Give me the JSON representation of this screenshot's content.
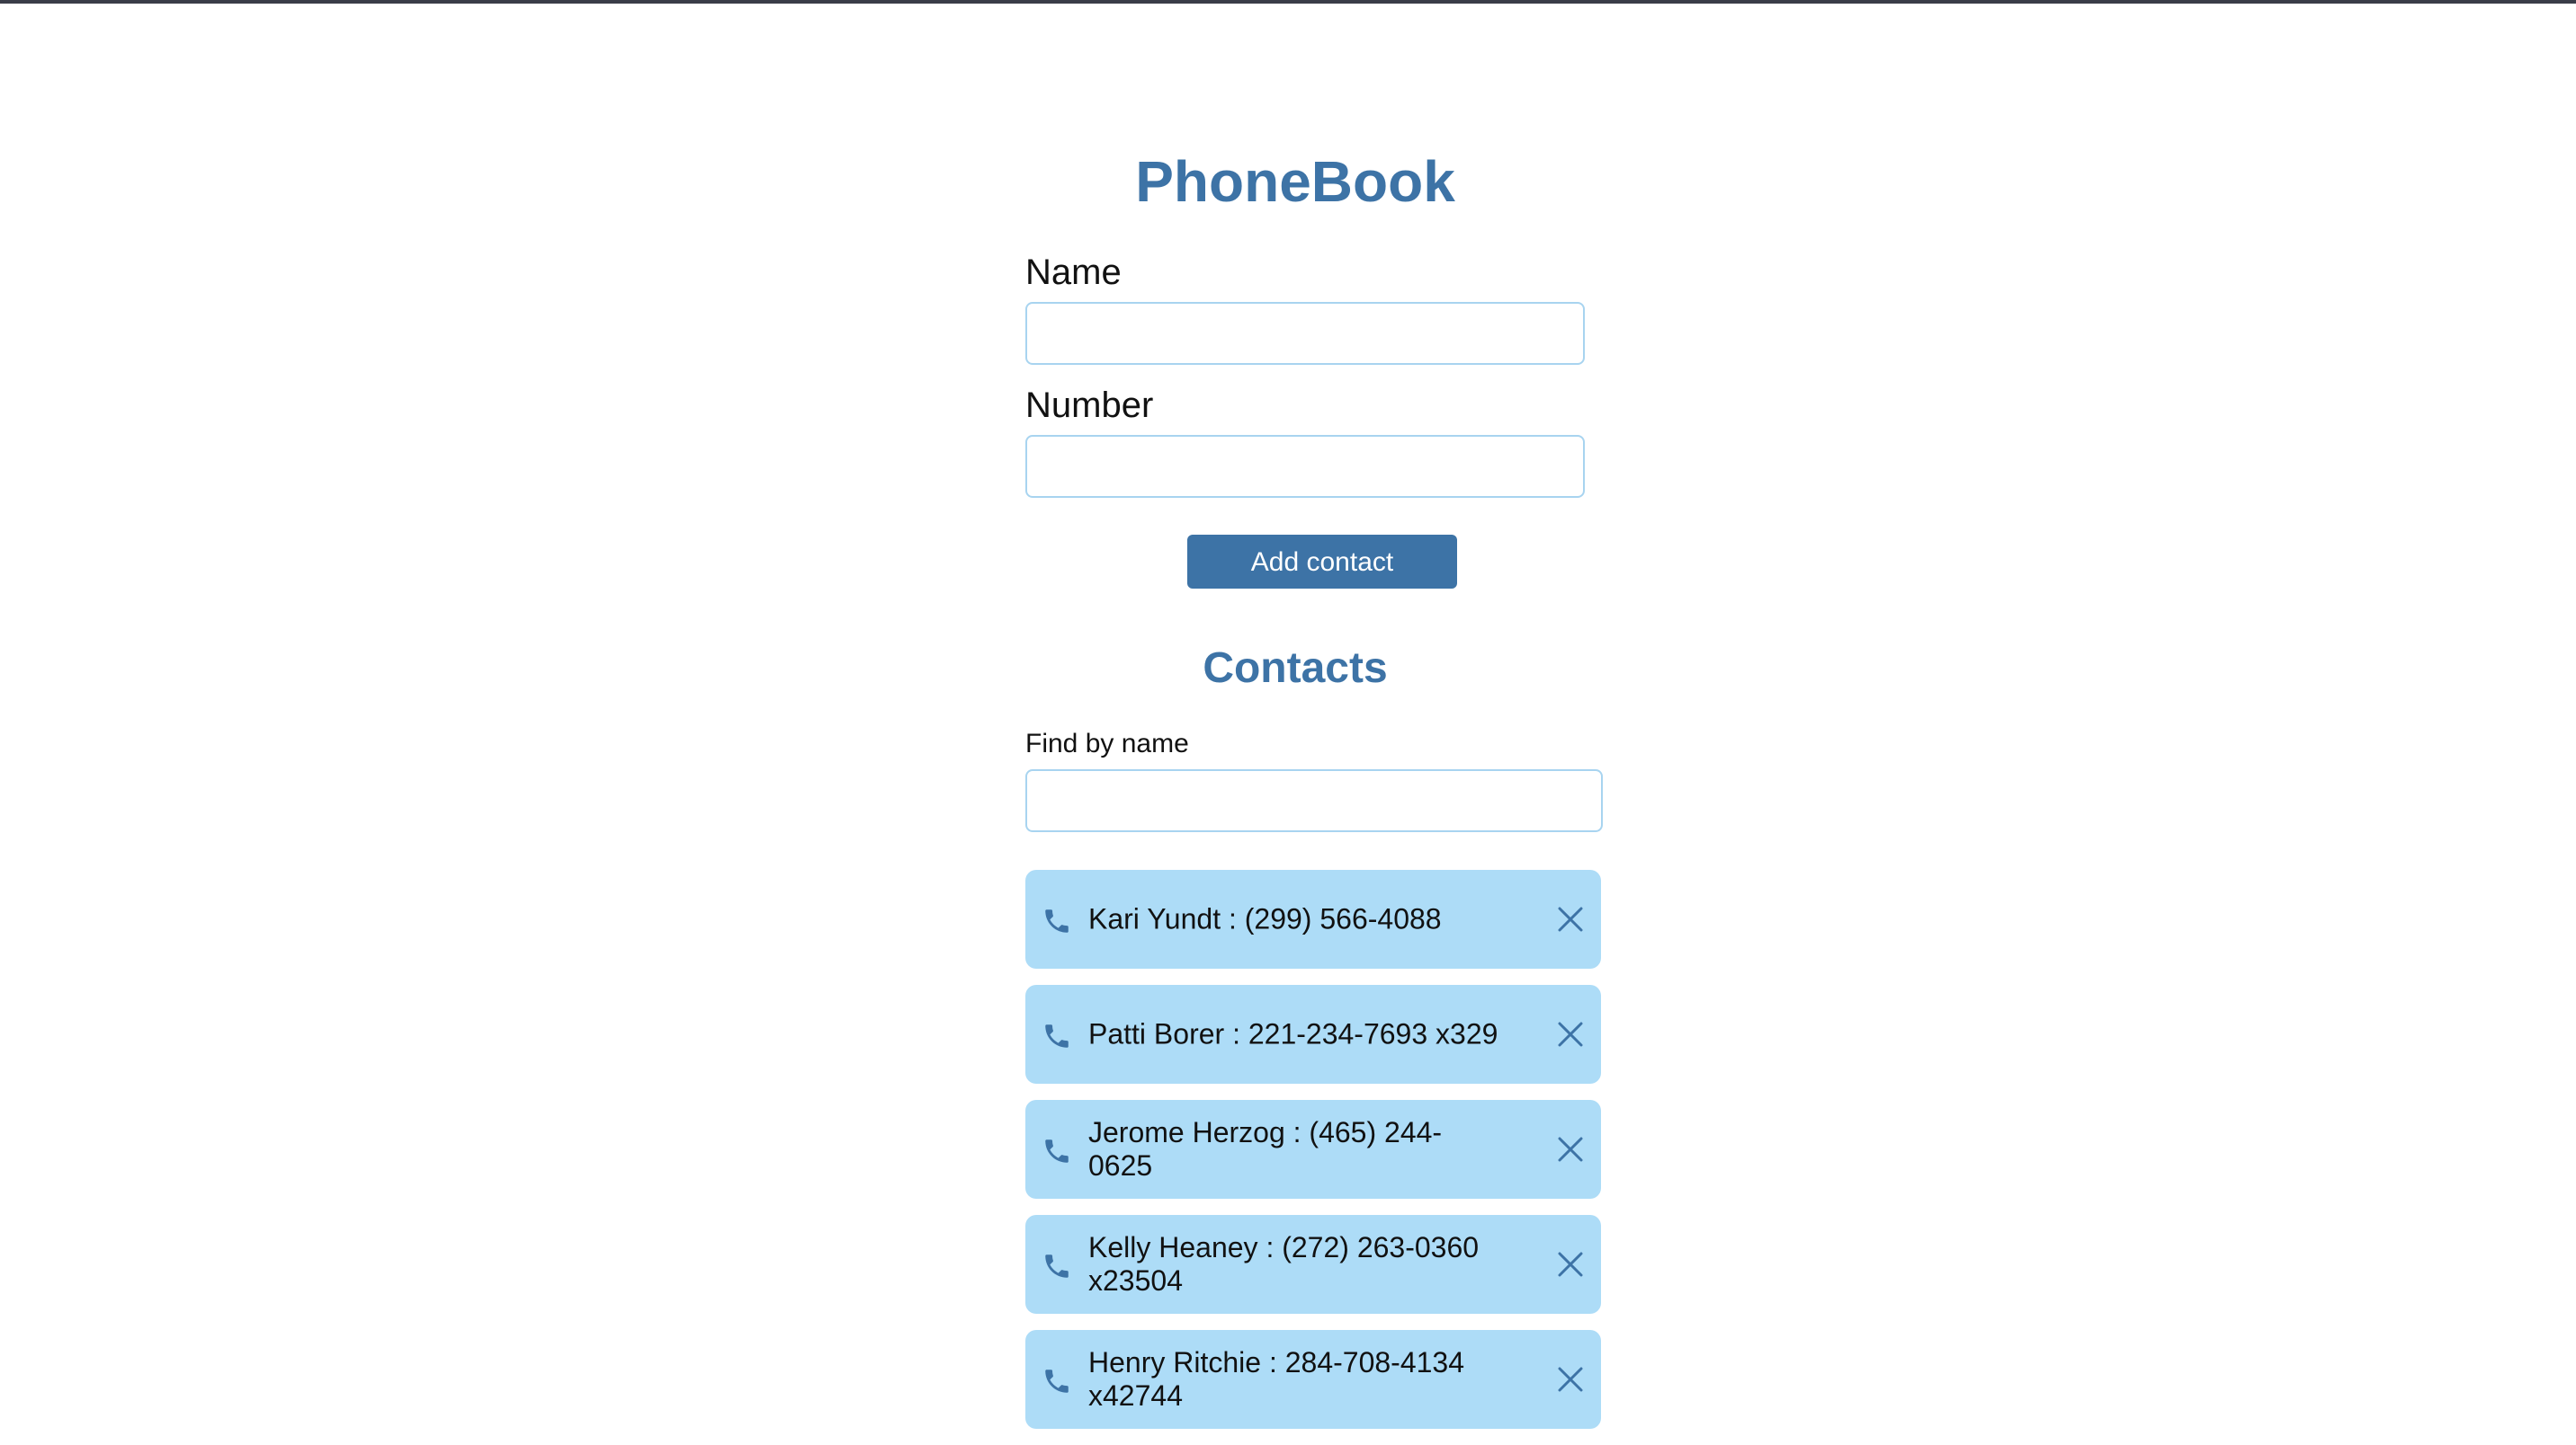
{
  "app": {
    "title": "PhoneBook"
  },
  "form": {
    "name_label": "Name",
    "name_value": "",
    "number_label": "Number",
    "number_value": "",
    "submit_label": "Add contact"
  },
  "contacts_section": {
    "title": "Contacts",
    "filter_label": "Find by name",
    "filter_value": ""
  },
  "contacts": [
    {
      "text": "Kari Yundt : (299) 566-4088"
    },
    {
      "text": "Patti Borer : 221-234-7693 x329"
    },
    {
      "text": "Jerome Herzog : (465) 244-0625"
    },
    {
      "text": "Kelly Heaney : (272) 263-0360 x23504"
    },
    {
      "text": "Henry Ritchie : 284-708-4134 x42744"
    }
  ],
  "colors": {
    "accent": "#3d73a6",
    "contact_card_bg": "#addcf7",
    "input_border": "#a8d4f0",
    "top_bar": "#3a3d48"
  },
  "icons": {
    "contact_icon": "phone-icon",
    "delete_icon": "close-icon"
  }
}
